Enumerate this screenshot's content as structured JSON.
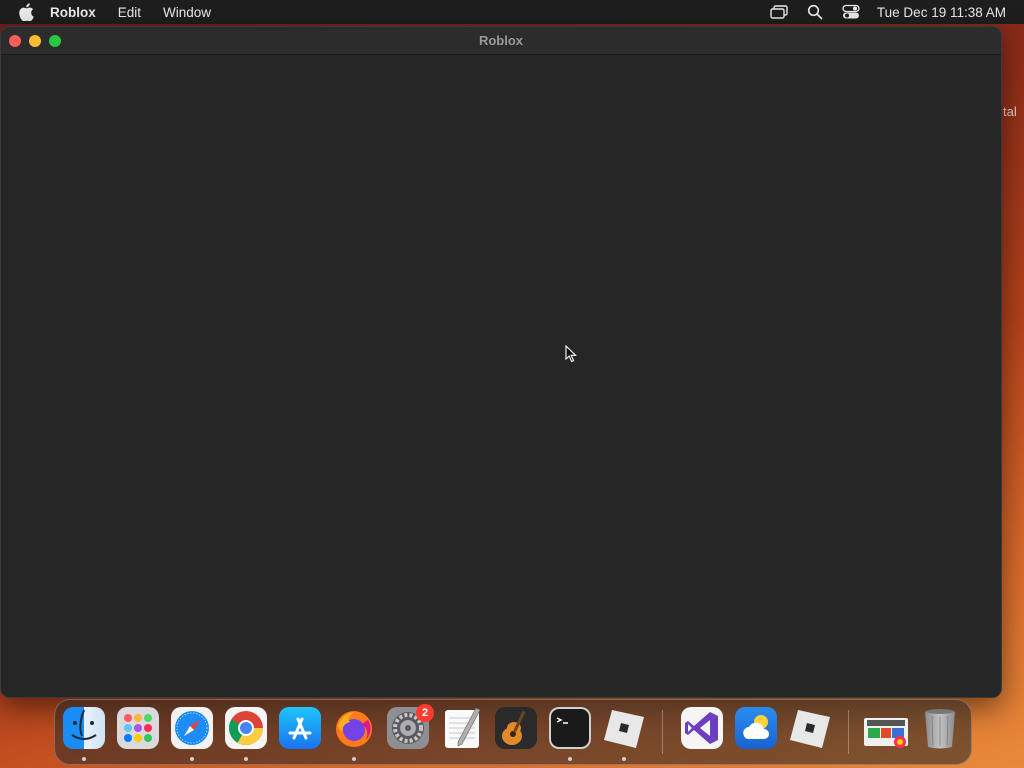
{
  "menubar": {
    "app_name": "Roblox",
    "items": [
      "Edit",
      "Window"
    ],
    "clock": "Tue Dec 19  11:38 AM"
  },
  "window": {
    "title": "Roblox"
  },
  "background_text": "tal",
  "dock": {
    "apps": [
      {
        "name": "Finder",
        "icon": "finder-icon",
        "running": true
      },
      {
        "name": "Launchpad",
        "icon": "launchpad-icon",
        "running": false
      },
      {
        "name": "Safari",
        "icon": "safari-icon",
        "running": true
      },
      {
        "name": "Google Chrome",
        "icon": "chrome-icon",
        "running": true
      },
      {
        "name": "App Store",
        "icon": "app-store-icon",
        "running": false
      },
      {
        "name": "Firefox",
        "icon": "firefox-icon",
        "running": true
      },
      {
        "name": "System Settings",
        "icon": "settings-icon",
        "running": false,
        "badge": "2"
      },
      {
        "name": "TextEdit",
        "icon": "textedit-icon",
        "running": false
      },
      {
        "name": "GarageBand",
        "icon": "garageband-icon",
        "running": false
      },
      {
        "name": "Terminal",
        "icon": "terminal-icon",
        "running": true
      },
      {
        "name": "Roblox",
        "icon": "roblox-icon",
        "running": true
      },
      {
        "name": "Visual Studio",
        "icon": "visual-studio-icon",
        "running": false
      },
      {
        "name": "Weather",
        "icon": "weather-icon",
        "running": false
      },
      {
        "name": "Roblox Studio",
        "icon": "roblox-studio-icon",
        "running": false
      },
      {
        "name": "Downloads",
        "icon": "downloads-stack-icon",
        "running": false
      },
      {
        "name": "Trash",
        "icon": "trash-icon",
        "running": false
      }
    ]
  }
}
